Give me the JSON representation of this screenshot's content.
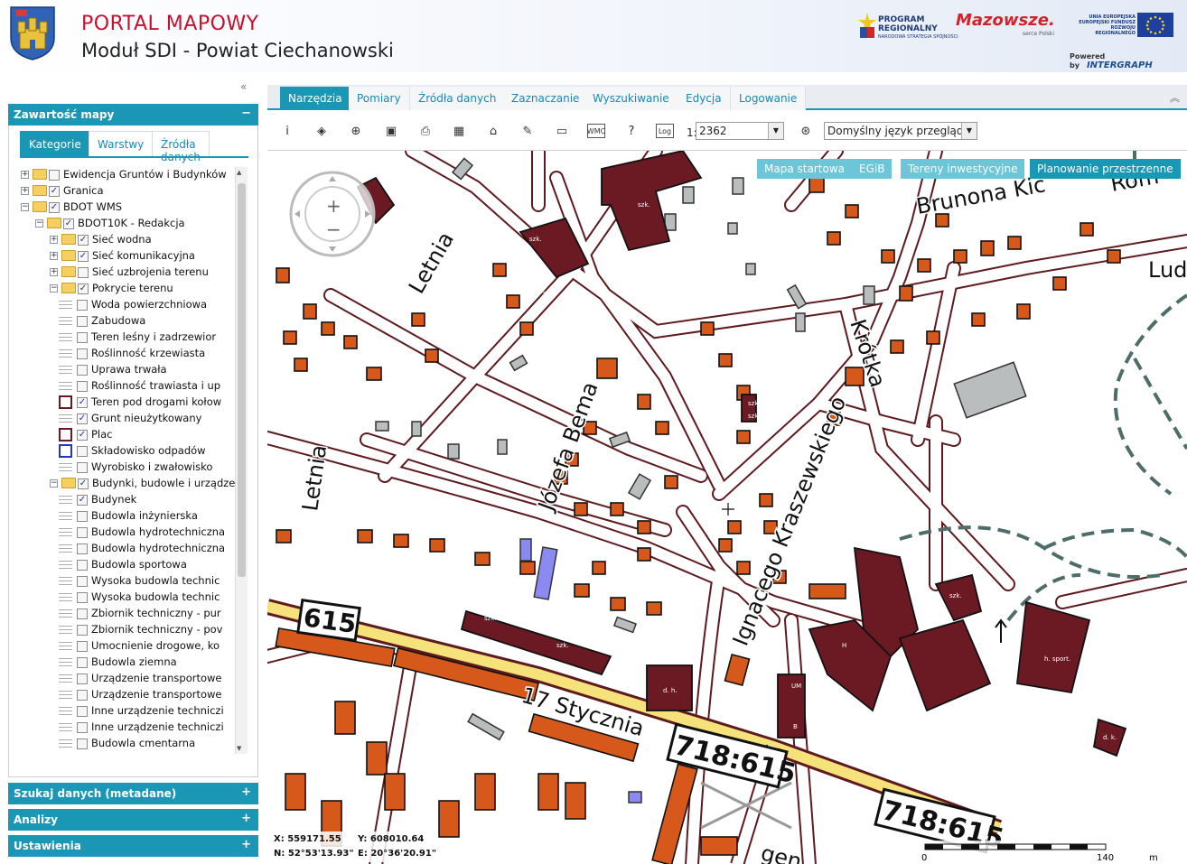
{
  "header": {
    "title": "PORTAL MAPOWY",
    "subtitle": "Moduł SDI - Powiat Ciechanowski",
    "logo_program_line1": "PROGRAM",
    "logo_program_line2": "REGIONALNY",
    "logo_program_sub": "NARODOWA STRATEGIA SPÓJNOŚCI",
    "logo_mazowsze": "Mazowsze.",
    "logo_mazowsze_sub": "serce Polski",
    "logo_ue_line1": "UNIA EUROPEJSKA",
    "logo_ue_line2": "EUROPEJSKI FUNDUSZ",
    "logo_ue_line3": "ROZWOJU REGIONALNEGO",
    "powered_by": "Powered by",
    "powered_brand": "INTERGRAPH"
  },
  "left_panel": {
    "collapse_icon": "double-chevron-left-icon",
    "content_title": "Zawartość mapy",
    "content_ctl": "−",
    "tabs": [
      {
        "label": "Kategorie",
        "active": true
      },
      {
        "label": "Warstwy",
        "active": false
      },
      {
        "label": "Źródła danych",
        "active": false
      }
    ],
    "tree": [
      {
        "label": "Ewidencja Gruntów i Budynków",
        "level": 0,
        "exp": "+",
        "folder": true,
        "checked": false
      },
      {
        "label": "Granica",
        "level": 0,
        "exp": "+",
        "folder": true,
        "checked": true
      },
      {
        "label": "BDOT WMS",
        "level": 0,
        "exp": "−",
        "folder": true,
        "checked": true
      },
      {
        "label": "BDOT10K - Redakcja",
        "level": 1,
        "exp": "−",
        "folder": true,
        "checked": true
      },
      {
        "label": "Sieć wodna",
        "level": 2,
        "exp": "+",
        "folder": true,
        "checked": true
      },
      {
        "label": "Sieć komunikacyjna",
        "level": 2,
        "exp": "+",
        "folder": true,
        "checked": true
      },
      {
        "label": "Sieć uzbrojenia terenu",
        "level": 2,
        "exp": "+",
        "folder": true,
        "checked": false
      },
      {
        "label": "Pokrycie terenu",
        "level": 2,
        "exp": "−",
        "folder": true,
        "checked": true
      },
      {
        "label": "Woda powierzchniowa",
        "level": 3,
        "legend": "lines",
        "checked": false
      },
      {
        "label": "Zabudowa",
        "level": 3,
        "legend": "lines",
        "checked": false
      },
      {
        "label": "Teren leśny i zadrzewior",
        "level": 3,
        "legend": "lines",
        "checked": false
      },
      {
        "label": "Roślinność krzewiasta",
        "level": 3,
        "legend": "lines",
        "checked": false
      },
      {
        "label": "Uprawa trwała",
        "level": 3,
        "legend": "lines",
        "checked": false
      },
      {
        "label": "Roślinność trawiasta i up",
        "level": 3,
        "legend": "lines",
        "checked": false
      },
      {
        "label": "Teren pod drogami kołow",
        "level": 3,
        "legend": "red-box",
        "checked": true
      },
      {
        "label": "Grunt nieużytkowany",
        "level": 3,
        "legend": "lines",
        "checked": true
      },
      {
        "label": "Plac",
        "level": 3,
        "legend": "red-box",
        "checked": true
      },
      {
        "label": "Składowisko odpadów",
        "level": 3,
        "legend": "blue-box",
        "checked": false
      },
      {
        "label": "Wyrobisko i zwałowisko",
        "level": 3,
        "legend": "lines",
        "checked": false
      },
      {
        "label": "Budynki, budowle i urządzen",
        "level": 2,
        "exp": "−",
        "folder": true,
        "checked": true
      },
      {
        "label": "Budynek",
        "level": 3,
        "legend": "lines",
        "checked": true
      },
      {
        "label": "Budowla inżynierska",
        "level": 3,
        "legend": "lines",
        "checked": false
      },
      {
        "label": "Budowla hydrotechniczna",
        "level": 3,
        "legend": "lines",
        "checked": false
      },
      {
        "label": "Budowla hydrotechniczna",
        "level": 3,
        "legend": "lines",
        "checked": false
      },
      {
        "label": "Budowla sportowa",
        "level": 3,
        "legend": "lines",
        "checked": false
      },
      {
        "label": "Wysoka budowla technic",
        "level": 3,
        "legend": "lines",
        "checked": false
      },
      {
        "label": "Wysoka budowla technic",
        "level": 3,
        "legend": "lines",
        "checked": false
      },
      {
        "label": "Zbiornik techniczny - pur",
        "level": 3,
        "legend": "lines",
        "checked": false
      },
      {
        "label": "Zbiornik techniczny - pov",
        "level": 3,
        "legend": "lines",
        "checked": false
      },
      {
        "label": "Umocnienie drogowe, ko",
        "level": 3,
        "legend": "lines",
        "checked": false
      },
      {
        "label": "Budowla ziemna",
        "level": 3,
        "legend": "lines",
        "checked": false
      },
      {
        "label": "Urządzenie transportowe",
        "level": 3,
        "legend": "lines",
        "checked": false
      },
      {
        "label": "Urządzenie transportowe",
        "level": 3,
        "legend": "lines",
        "checked": false
      },
      {
        "label": "Inne urządzenie techniczi",
        "level": 3,
        "legend": "lines",
        "checked": false
      },
      {
        "label": "Inne urządzenie techniczi",
        "level": 3,
        "legend": "lines",
        "checked": false
      },
      {
        "label": "Budowla cmentarna",
        "level": 3,
        "legend": "lines",
        "checked": false
      }
    ],
    "sections": [
      {
        "label": "Szukaj danych (metadane)",
        "ctl": "+"
      },
      {
        "label": "Analizy",
        "ctl": "+"
      },
      {
        "label": "Ustawienia",
        "ctl": "+"
      }
    ]
  },
  "top_tabs": [
    {
      "label": "Narzędzia",
      "active": true
    },
    {
      "label": "Pomiary",
      "active": false
    },
    {
      "label": "Źródła danych",
      "active": false
    },
    {
      "label": "Zaznaczanie",
      "active": false
    },
    {
      "label": "Wyszukiwanie",
      "active": false
    },
    {
      "label": "Edycja",
      "active": false
    },
    {
      "label": "Logowanie",
      "active": false
    }
  ],
  "toolbar": {
    "tools": [
      {
        "icon": "info-icon",
        "glyph": "i"
      },
      {
        "icon": "pyramid-icon",
        "glyph": "◈"
      },
      {
        "icon": "zoom-icon",
        "glyph": "⊕"
      },
      {
        "icon": "save-icon",
        "glyph": "▣"
      },
      {
        "icon": "print-icon",
        "glyph": "⎙"
      },
      {
        "icon": "table-icon",
        "glyph": "▦"
      },
      {
        "icon": "home-icon",
        "glyph": "⌂"
      },
      {
        "icon": "pencil-icon",
        "glyph": "✎"
      },
      {
        "icon": "folder-icon",
        "glyph": "▭"
      },
      {
        "icon": "wmc-icon",
        "glyph": "WMC"
      },
      {
        "icon": "help-icon",
        "glyph": "?"
      },
      {
        "icon": "log-icon",
        "glyph": "Log"
      }
    ],
    "scale_prefix": "1:",
    "scale_value": "2362",
    "zoom_scale_icon": "zoom-scale-icon",
    "language": "Domyślny język przeglądarki"
  },
  "map": {
    "buttons": [
      {
        "label": "Mapa startowa",
        "active": false
      },
      {
        "label": "EGiB",
        "active": false
      },
      {
        "label": "Tereny inwestycyjne",
        "active": false
      },
      {
        "label": "Planowanie przestrzenne",
        "active": true
      }
    ],
    "nav_plus": "+",
    "nav_minus": "−",
    "street_labels": [
      "Letnia",
      "Letnia",
      "Józefa Bema",
      "Ignacego Kraszewskiego",
      "Krótka",
      "Brunona Kic",
      "Rom",
      "Lud",
      "17 Stycznia",
      "gen"
    ],
    "road_numbers": [
      "615",
      "718:615",
      "718:615"
    ],
    "building_labels": [
      "szk.",
      "szk.",
      "szk.",
      "szk.",
      "szk.",
      "szk.",
      "szk.",
      "szk.",
      "H",
      "UM",
      "B",
      "d. h.",
      "h. sport.",
      "d. k.",
      "d. k."
    ],
    "coords": {
      "x_label": "X:",
      "x_value": "559171.55",
      "y_label": "Y:",
      "y_value": "608010.64",
      "n_label": "N:",
      "n_value": "52°53'13.93\"",
      "e_label": "E:",
      "e_value": "20°36'20.91\""
    },
    "scalebar": {
      "start": "0",
      "end": "140",
      "unit": "m"
    }
  }
}
